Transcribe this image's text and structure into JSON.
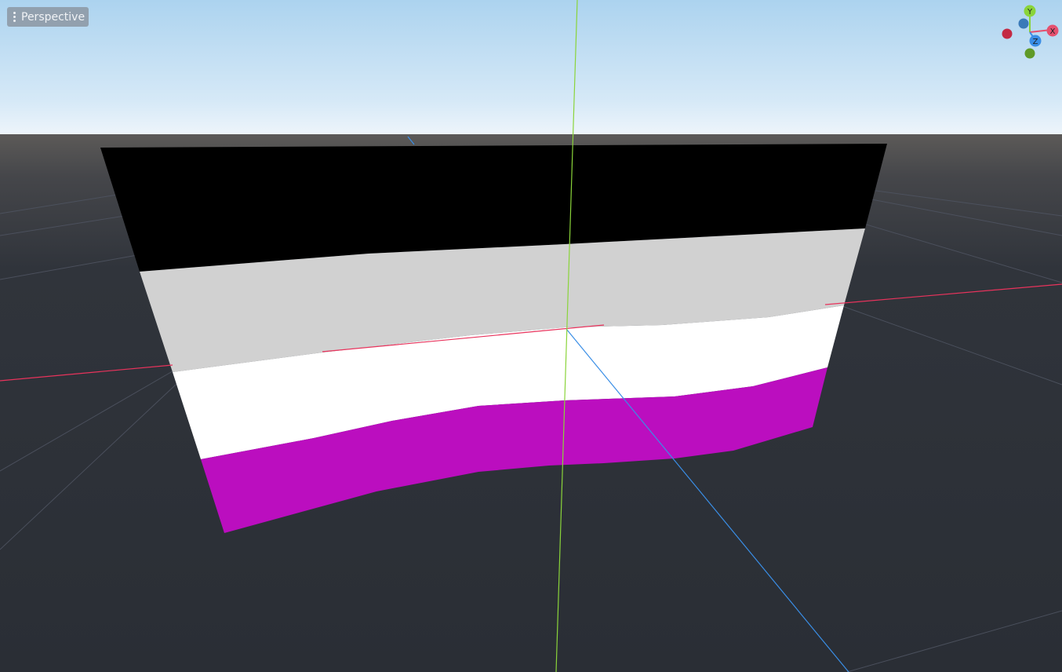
{
  "viewport": {
    "view_mode_label": "Perspective",
    "colors": {
      "sky_top": "#acd3ef",
      "sky_horizon": "#eef5fb",
      "ground_near_horizon": "#5c5a58",
      "ground": "#2a2e35",
      "grid_line": "#4e5360",
      "x_axis": "#e8335c",
      "y_axis": "#8ad43a",
      "z_axis": "#3a8ee6"
    }
  },
  "mesh": {
    "stripe_colors": [
      "#000000",
      "#d1d1d1",
      "#ffffff",
      "#bb0ebf"
    ]
  },
  "gizmo": {
    "y_label": "Y",
    "x_label": "X",
    "z_label": "Z",
    "colors": {
      "x": "#e5506e",
      "y": "#8ad43a",
      "z": "#3a8ee6",
      "neg_x": "#c32a44",
      "neg_y": "#5f9a28",
      "neg_z": "#3a7ab8"
    }
  }
}
